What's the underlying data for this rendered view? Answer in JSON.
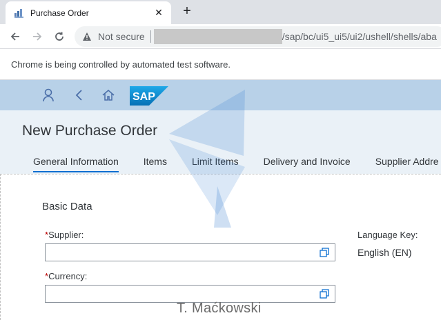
{
  "browser": {
    "tab_title": "Purchase Order",
    "security_label": "Not secure",
    "url_visible": "/sap/bc/ui5_ui5/ui2/ushell/shells/aba",
    "infobar_text": "Chrome is being controlled by automated test software."
  },
  "app": {
    "title": "New Purchase Order",
    "logo_text": "SAP",
    "tabs": [
      {
        "label": "General Information"
      },
      {
        "label": "Items"
      },
      {
        "label": "Limit Items"
      },
      {
        "label": "Delivery and Invoice"
      },
      {
        "label": "Supplier Addre"
      }
    ],
    "section_title": "Basic Data",
    "required_mark": "*",
    "supplier_label": "Supplier:",
    "currency_label": "Currency:",
    "language_key_label": "Language Key:",
    "language_key_value": "English (EN)"
  },
  "watermark": {
    "text": "T. Maćkowski"
  },
  "colors": {
    "accent": "#0a6ed1",
    "shell": "#b8d1e8",
    "header": "#eaf1f7",
    "required": "#bb0000"
  }
}
